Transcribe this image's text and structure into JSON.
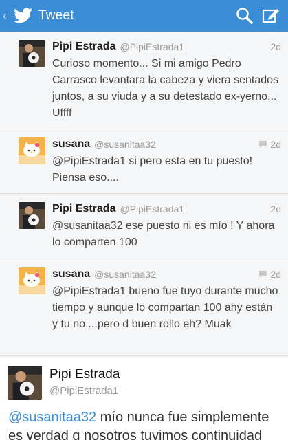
{
  "app": {
    "title": "Tweet",
    "accent": "#3b8ed6"
  },
  "actionbar": {
    "icons": [
      "back-chevron-icon",
      "twitter-bird-icon",
      "search-icon",
      "compose-icon"
    ]
  },
  "tweets": [
    {
      "name": "Pipi Estrada",
      "handle": "@PipiEstrada1",
      "time": "2d",
      "avatar": "pipi-avatar",
      "text": "Curioso momento... Si mi amigo Pedro Carrasco levantara la cabeza y viera sentados juntos, a su viuda y a su detestado ex-yerno... Uffff"
    },
    {
      "name": "susana",
      "handle": "@susanitaa32",
      "time": "2d",
      "avatar": "hello-kitty-avatar",
      "text": "@PipiEstrada1 si pero esta en tu puesto! Piensa eso...."
    },
    {
      "name": "Pipi Estrada",
      "handle": "@PipiEstrada1",
      "time": "2d",
      "avatar": "pipi-avatar",
      "text": "@susanitaa32 ese puesto ni es mío ! Y ahora lo comparten 100"
    },
    {
      "name": "susana",
      "handle": "@susanitaa32",
      "time": "2d",
      "avatar": "hello-kitty-avatar",
      "text": "@PipiEstrada1 bueno fue tuyo durante mucho tiempo y aunque lo compartan 100 ahy están y tu no....pero d buen rollo eh? Muak"
    }
  ],
  "focused": {
    "name": "Pipi Estrada",
    "handle": "@PipiEstrada1",
    "mention": "@susanitaa32",
    "text_line1": " mío nunca fue simplemente",
    "text_line2": "es verdad q nosotros tuvimos continuidad"
  }
}
